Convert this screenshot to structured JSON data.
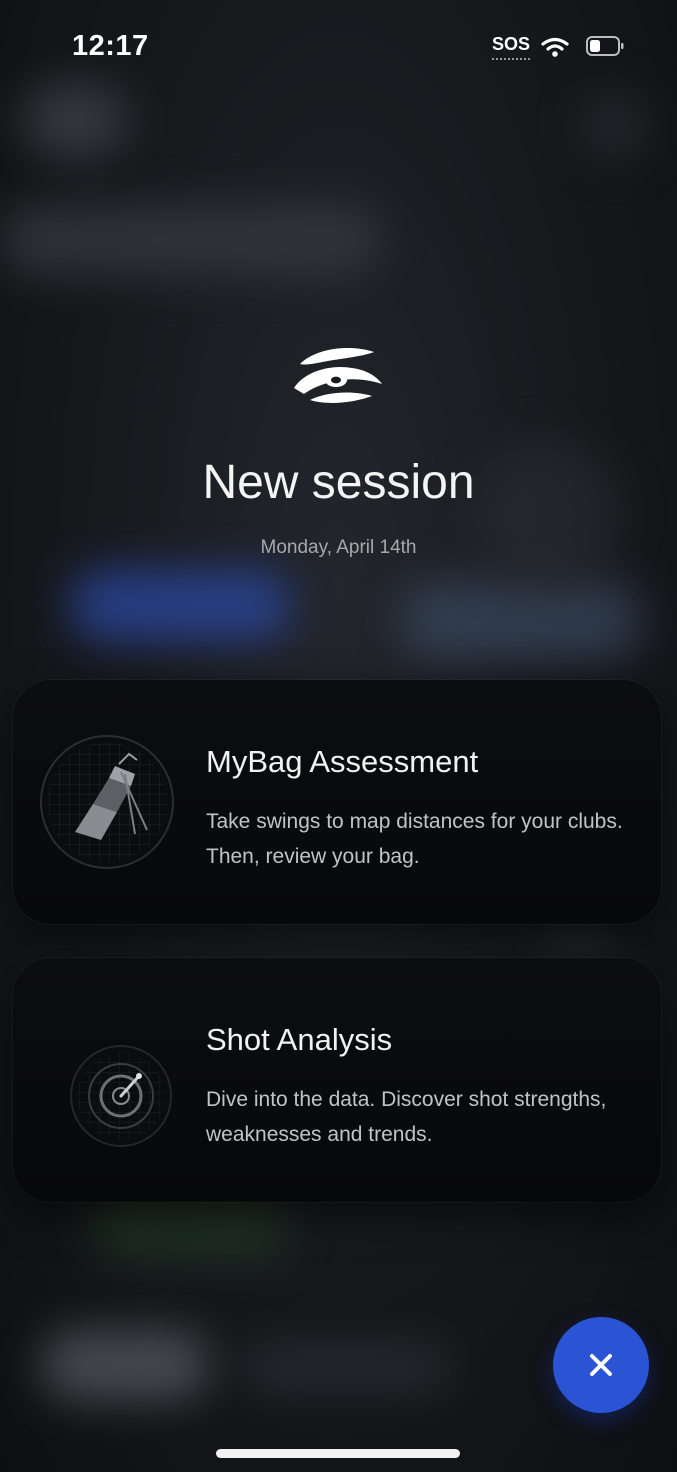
{
  "status_bar": {
    "time": "12:17",
    "sos": "SOS",
    "icons": [
      "wifi-icon",
      "battery-icon"
    ]
  },
  "header": {
    "logo_icon": "app-logo-icon",
    "title": "New session",
    "date": "Monday, April 14th"
  },
  "options": [
    {
      "title": "MyBag Assessment",
      "description": "Take swings to map distances for your clubs. Then, review your bag.",
      "icon": "golf-bag-icon"
    },
    {
      "title": "Shot Analysis",
      "description": "Dive into the data. Discover shot strengths, weaknesses and trends.",
      "icon": "radar-icon"
    }
  ],
  "close_button": {
    "icon": "close-icon",
    "color": "#2a54d4"
  },
  "colors": {
    "accent": "#2a54d4",
    "card_background": "#0a0b0e",
    "text_primary": "#f4f4f4",
    "text_secondary": "#a8a8ab"
  }
}
